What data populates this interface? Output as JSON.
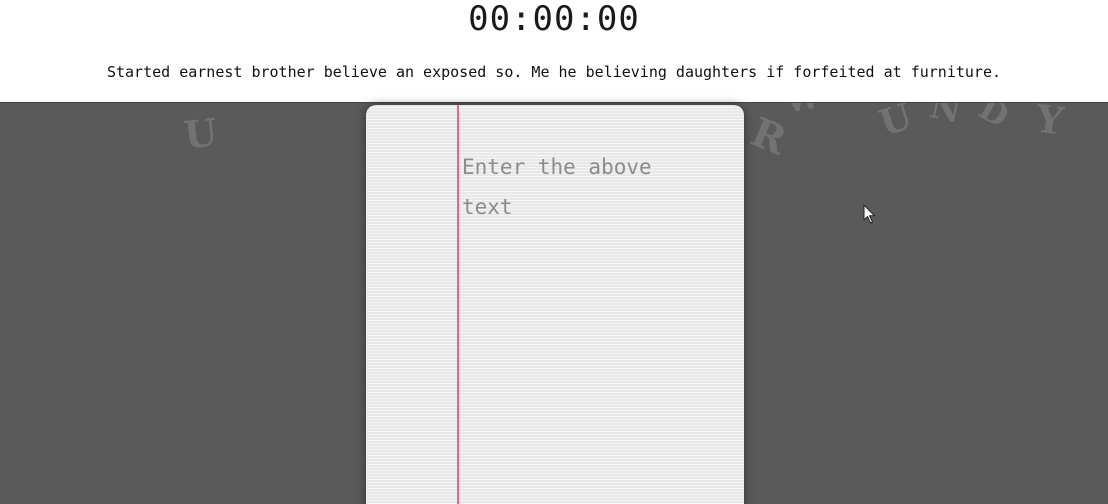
{
  "timer": {
    "value": "00:00:00"
  },
  "prompt": {
    "text": "Started earnest brother believe an exposed so. Me he believing daughters if forfeited at furniture."
  },
  "editor": {
    "placeholder": "Enter the above\ntext",
    "value": ""
  },
  "decor": {
    "letters": [
      "U",
      "R",
      "U",
      "N",
      "D",
      "Y",
      "W"
    ],
    "icon": "mouse-pointer-icon"
  },
  "colors": {
    "backdrop": "#5a5a5a",
    "paper": "#eeeeee",
    "rule_line": "#c3cbf0",
    "margin_line": "#e06a8a"
  }
}
